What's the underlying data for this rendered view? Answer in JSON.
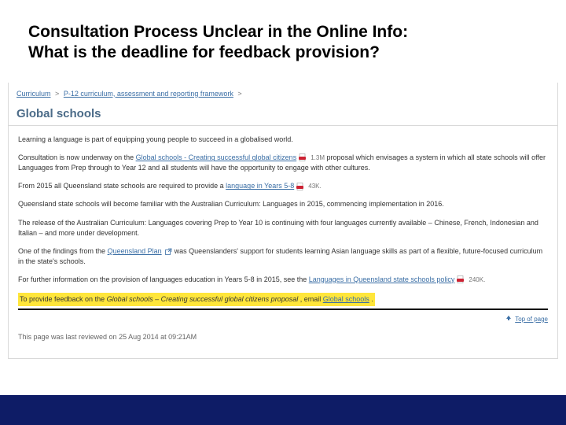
{
  "slide": {
    "title_line1": "Consultation Process Unclear in the Online Info:",
    "title_line2": "What is the deadline for feedback provision?"
  },
  "breadcrumb": {
    "item1": "Curriculum",
    "item2": "P-12 curriculum, assessment and reporting framework"
  },
  "page": {
    "heading": "Global schools",
    "p_intro": "Learning a language is part of equipping young people to succeed in a globalised world.",
    "p_consult_pre": "Consultation is now underway on the ",
    "p_consult_link": "Global schools - Creating successful global citizens",
    "p_consult_size": "1.3M",
    "p_consult_post": " proposal which envisages a system in which all state schools will offer Languages from Prep through to Year 12 and all students will have the opportunity to engage with other cultures.",
    "p_2015_pre": "From 2015 all Queensland state schools are required to provide a ",
    "p_2015_link": "language in Years 5-8",
    "p_2015_size": "43K.",
    "p_austcurr": "Queensland state schools will become familiar with the Australian Curriculum: Languages in 2015, commencing implementation in 2016.",
    "p_release": "The release of the Australian Curriculum: Languages covering Prep to Year 10 is continuing with four languages currently available – Chinese, French, Indonesian and Italian – and more under development.",
    "p_qplan_pre": "One of the findings from the ",
    "p_qplan_link": "Queensland Plan",
    "p_qplan_post": " was Queenslanders' support for students learning Asian language skills as part of a flexible, future-focused curriculum in the state's schools.",
    "p_further_pre": "For further information on the provision of languages education in Years 5-8 in 2015, see the ",
    "p_further_link": "Languages in Queensland state schools policy",
    "p_further_size": "240K.",
    "hl_pre": "To provide feedback on the ",
    "hl_em": "Global schools – Creating successful global citizens proposal",
    "hl_mid": ", email ",
    "hl_link": "Global schools",
    "hl_post": ".",
    "top_of_page": "Top of page",
    "last_reviewed": "This page was last reviewed on 25 Aug 2014 at 09:21AM"
  }
}
